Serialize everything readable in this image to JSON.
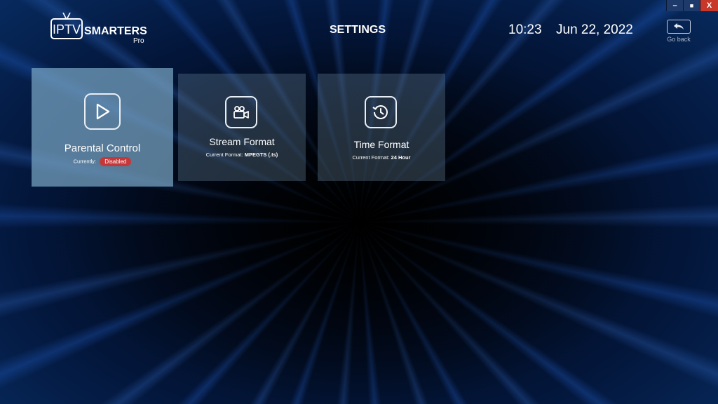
{
  "window": {
    "minimize_label": "–",
    "maximize_label": "■",
    "close_label": "X"
  },
  "brand": {
    "prefix": "IPTV",
    "name": "SMARTERS",
    "suffix": "Pro"
  },
  "header": {
    "title": "SETTINGS",
    "time": "10:23",
    "date": "Jun 22, 2022",
    "back_label": "Go back"
  },
  "cards": [
    {
      "title": "Parental Control",
      "sub_label": "Currently:",
      "sub_value": "Disabled",
      "icon": "play-icon",
      "selected": true
    },
    {
      "title": "Stream Format",
      "sub_label": "Current Format:",
      "sub_value": "MPEGTS (.ts)",
      "icon": "video-camera-icon"
    },
    {
      "title": "Time Format",
      "sub_label": "Current Format:",
      "sub_value": "24 Hour",
      "icon": "history-clock-icon"
    }
  ],
  "colors": {
    "badge": "#c4383a",
    "accent": "#1e63d6"
  }
}
